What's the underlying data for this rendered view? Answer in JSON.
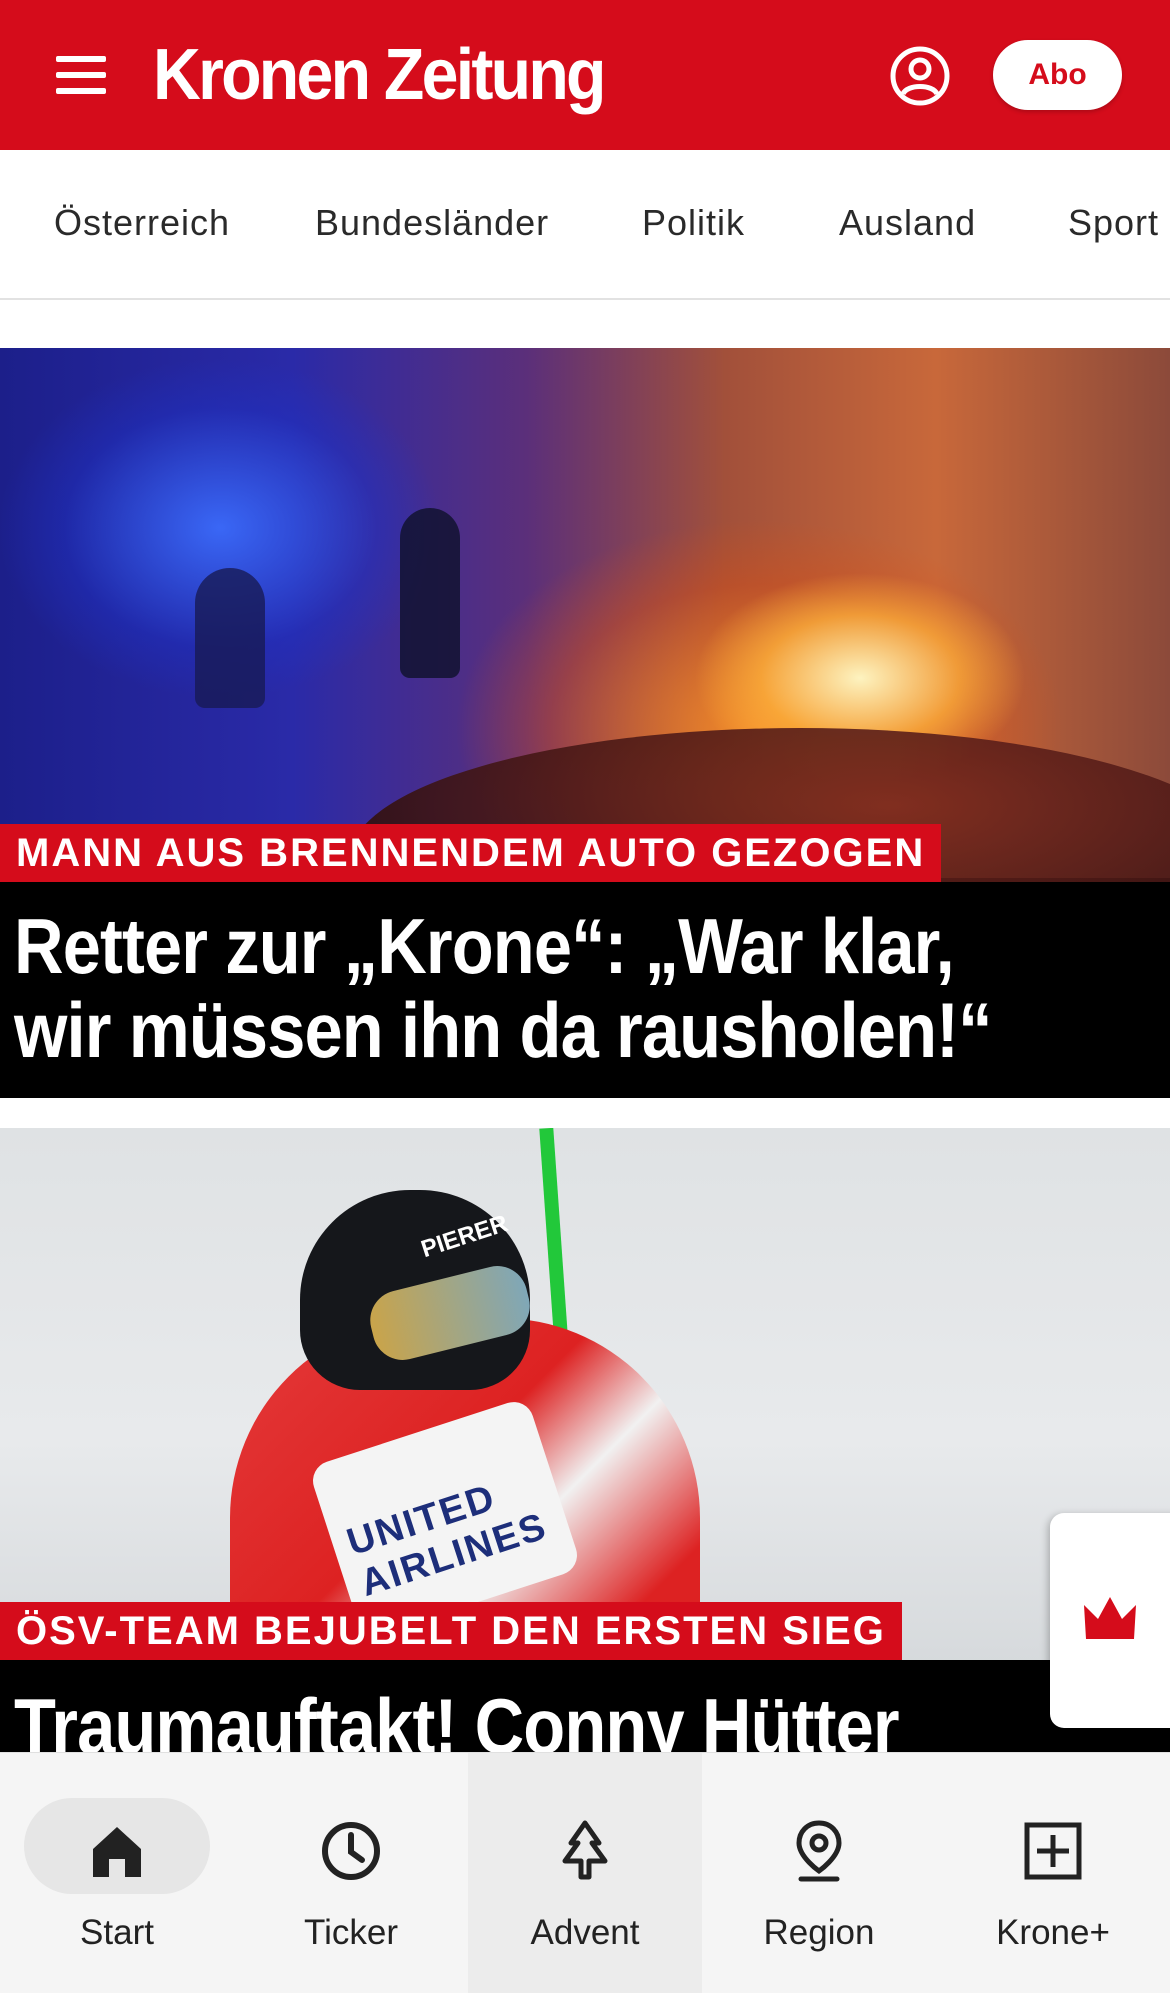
{
  "header": {
    "logo": "Kronen Zeitung",
    "abo_label": "Abo",
    "brand_color": "#d50c1b"
  },
  "categories": [
    "Österreich",
    "Bundesländer",
    "Politik",
    "Ausland",
    "Sport"
  ],
  "articles": [
    {
      "kicker": "MANN AUS BRENNENDEM AUTO GEZOGEN",
      "headline_line1": "Retter zur „Krone“: „War klar,",
      "headline_line2": "wir müssen ihn da rausholen!“"
    },
    {
      "kicker": "ÖSV-TEAM BEJUBELT DEN ERSTEN SIEG",
      "headline_line1": "Traumauftakt! Conny Hütter",
      "image_text_helmet": "PIERER",
      "image_text_bib": "UNITED AIRLINES"
    }
  ],
  "bottom_nav": [
    {
      "label": "Start",
      "icon": "home-icon",
      "selected": true
    },
    {
      "label": "Ticker",
      "icon": "clock-icon"
    },
    {
      "label": "Advent",
      "icon": "tree-icon"
    },
    {
      "label": "Region",
      "icon": "location-pin-icon"
    },
    {
      "label": "Krone+",
      "icon": "plus-box-icon"
    }
  ]
}
